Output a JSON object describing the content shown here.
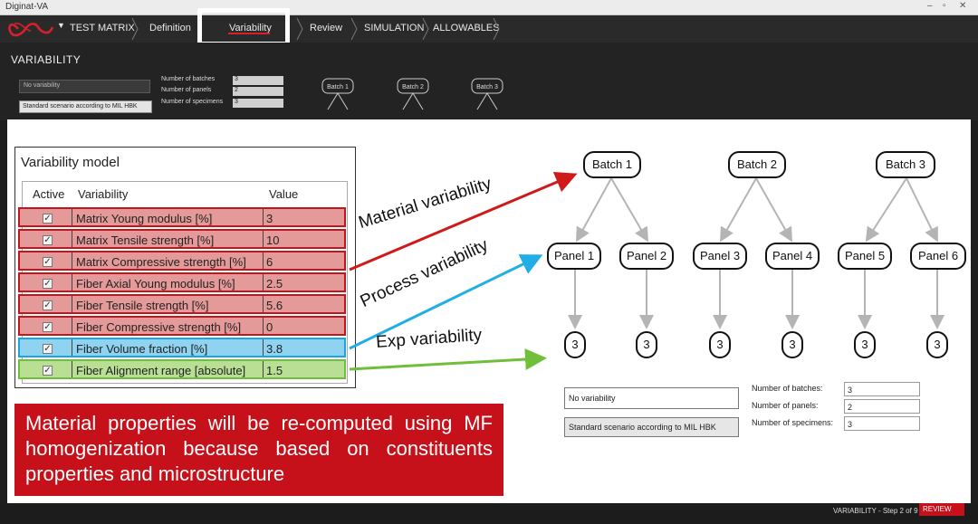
{
  "app": {
    "title": "Diginat-VA"
  },
  "window_controls": {
    "minimize": "–",
    "maximize": "▫",
    "close": "✕"
  },
  "nav": {
    "items": [
      "TEST MATRIX",
      "Definition",
      "Variability",
      "Review",
      "SIMULATION",
      "ALLOWABLES"
    ],
    "active": "Variability"
  },
  "section": {
    "title": "VARIABILITY",
    "variability_field": "No variability",
    "scenario_button": "Standard scenario according to MIL HBK",
    "labels": [
      "Number of batches",
      "Number of panels",
      "Number of specimens"
    ],
    "values": [
      "3",
      "2",
      "3"
    ],
    "batches": [
      "Batch 1",
      "Batch 2",
      "Batch 3"
    ]
  },
  "model": {
    "title": "Variability model",
    "headers": [
      "Active",
      "Variability",
      "Value"
    ],
    "rows": [
      {
        "active": true,
        "name": "Matrix Young modulus [%]",
        "value": "3",
        "group": "material"
      },
      {
        "active": true,
        "name": "Matrix Tensile strength [%]",
        "value": "10",
        "group": "material"
      },
      {
        "active": true,
        "name": "Matrix Compressive strength [%]",
        "value": "6",
        "group": "material"
      },
      {
        "active": true,
        "name": "Fiber Axial Young modulus [%]",
        "value": "2.5",
        "group": "material"
      },
      {
        "active": true,
        "name": "Fiber Tensile strength [%]",
        "value": "5.6",
        "group": "material"
      },
      {
        "active": true,
        "name": "Fiber Compressive strength [%]",
        "value": "0",
        "group": "material"
      },
      {
        "active": true,
        "name": "Fiber Volume fraction [%]",
        "value": "3.8",
        "group": "process"
      },
      {
        "active": true,
        "name": "Fiber Alignment range [absolute]",
        "value": "1.5",
        "group": "experimental"
      }
    ],
    "colors": {
      "material": "#e59a9a",
      "process": "#8fd3f0",
      "experimental": "#b9df94"
    },
    "border_colors": {
      "material": "#c0161e",
      "process": "#1aa4e0",
      "experimental": "#6fbf3a"
    }
  },
  "annotations": {
    "material": "Material variability",
    "process": "Process variability",
    "experimental": "Exp variability"
  },
  "arrow_colors": {
    "material": "#d01a1a",
    "process": "#21aee6",
    "experimental": "#6fbf3a"
  },
  "tree": {
    "batches": [
      "Batch 1",
      "Batch 2",
      "Batch 3"
    ],
    "panels": [
      "Panel 1",
      "Panel 2",
      "Panel 3",
      "Panel 4",
      "Panel 5",
      "Panel 6"
    ],
    "specimens": [
      "3",
      "3",
      "3",
      "3",
      "3",
      "3"
    ]
  },
  "form": {
    "variability_field": "No variability",
    "scenario_button": "Standard scenario according to MIL HBK",
    "labels": [
      "Number of batches:",
      "Number of panels:",
      "Number of specimens:"
    ],
    "values": [
      "3",
      "2",
      "3"
    ]
  },
  "note": "Material properties will be re-computed using MF homogenization because based on constituents properties and microstructure",
  "status": {
    "text": "VARIABILITY - Step 2 of 9",
    "review": "REVIEW"
  }
}
